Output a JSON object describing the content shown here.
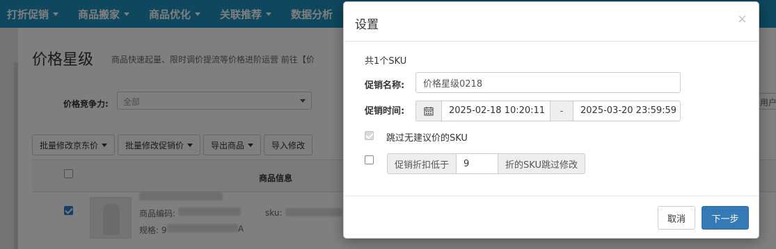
{
  "nav": {
    "items": [
      {
        "label": "打折促销"
      },
      {
        "label": "商品搬家"
      },
      {
        "label": "商品优化"
      },
      {
        "label": "关联推荐"
      },
      {
        "label": "数据分析"
      }
    ]
  },
  "page": {
    "title": "价格星级",
    "subtitle": "商品快速起量、限时调价提流等价格进阶运营 前往【价"
  },
  "filter": {
    "label": "价格竞争力:",
    "value": "全部",
    "right_cut_text": "用户自定义"
  },
  "toolbar": {
    "buttons": [
      {
        "label": "批量修改京东价",
        "has_caret": true
      },
      {
        "label": "批量修改促销价",
        "has_caret": true
      },
      {
        "label": "导出商品",
        "has_caret": true
      },
      {
        "label": "导入修改",
        "has_caret": false
      }
    ]
  },
  "table": {
    "header_info": "商品信息",
    "row": {
      "code_label": "商品编码:",
      "spec_label": "规格: 9",
      "spec_suffix": "A",
      "sku_label": "sku:"
    }
  },
  "modal": {
    "title": "设置",
    "close_symbol": "×",
    "sku_count": "共1个SKU",
    "promo_name_label": "促销名称:",
    "promo_name_value": "价格星级0218",
    "promo_time_label": "促销时间:",
    "start_time": "2025-02-18 10:20:11",
    "range_separator": "-",
    "end_time": "2025-03-20 23:59:59",
    "skip_no_price_label": "跳过无建议价的SKU",
    "discount_prefix": "促销折扣低于",
    "discount_value": "9",
    "discount_suffix": "折的SKU跳过修改",
    "cancel_label": "取消",
    "next_label": "下一步"
  }
}
